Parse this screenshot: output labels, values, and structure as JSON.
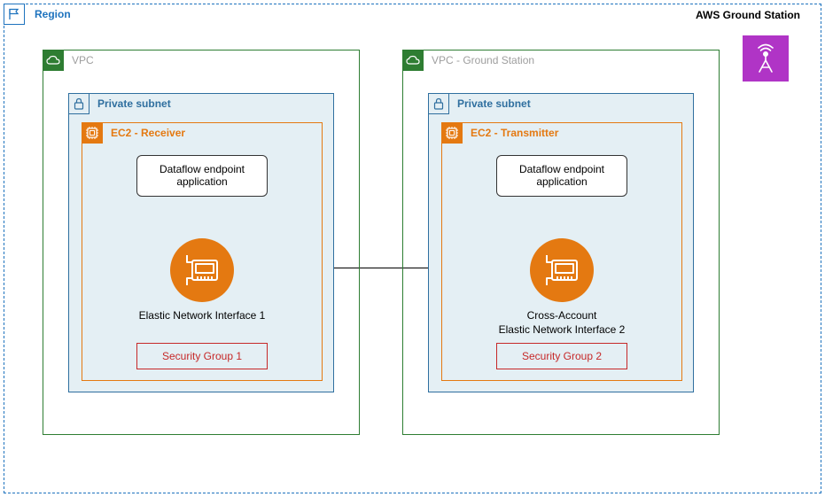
{
  "region": {
    "label": "Region"
  },
  "groundStation": {
    "label": "AWS Ground Station"
  },
  "vpc1": {
    "label": "VPC",
    "subnet": {
      "label": "Private subnet"
    },
    "ec2": {
      "label": "EC2 - Receiver",
      "dataflow": "Dataflow endpoint application",
      "eni_label": "Elastic Network Interface 1",
      "security_group": "Security Group 1"
    }
  },
  "vpc2": {
    "label": "VPC - Ground Station",
    "subnet": {
      "label": "Private subnet"
    },
    "ec2": {
      "label": "EC2 - Transmitter",
      "dataflow": "Dataflow endpoint application",
      "eni_label_line1": "Cross-Account",
      "eni_label_line2": "Elastic Network Interface 2",
      "security_group": "Security Group 2"
    }
  }
}
